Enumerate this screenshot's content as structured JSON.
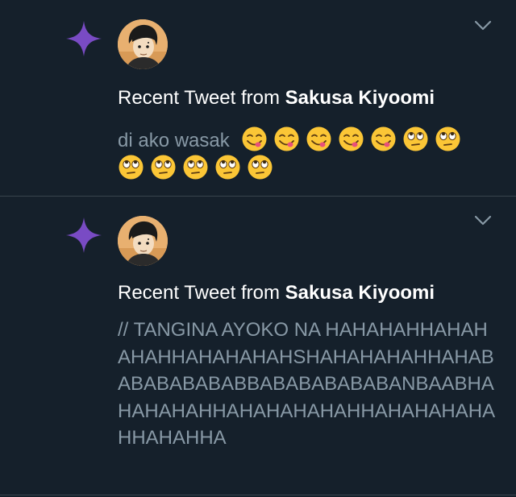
{
  "notifications": [
    {
      "headline_prefix": "Recent Tweet from ",
      "author": "Sakusa Kiyoomi",
      "text": "di ako wasak",
      "emojis_line1": [
        "yum-face",
        "yum-face",
        "yum-face",
        "yum-face",
        "yum-face",
        "eye-roll-face",
        "eye-roll-face"
      ],
      "emojis_line2": [
        "eye-roll-face",
        "eye-roll-face",
        "eye-roll-face",
        "eye-roll-face",
        "eye-roll-face"
      ]
    },
    {
      "headline_prefix": "Recent Tweet from ",
      "author": "Sakusa Kiyoomi",
      "text": "// TANGINA AYOKO NA HAHAHAHHAHAHAHAHHAHAHAHAHSHAHAHAHAHHAHABABABABABABBABABABABABANBAABHAHAHAHAHHAHAHAHAHAHHAHAHAHAHAHHAHAHHA"
    }
  ],
  "icons": {
    "sparkle": "sparkle-icon",
    "caret": "chevron-down-icon"
  },
  "colors": {
    "background": "#15202b",
    "divider": "#38444d",
    "primary_text": "#ffffff",
    "secondary_text": "#8899a6",
    "sparkle": "#794bc4",
    "caret": "#8899a6"
  }
}
